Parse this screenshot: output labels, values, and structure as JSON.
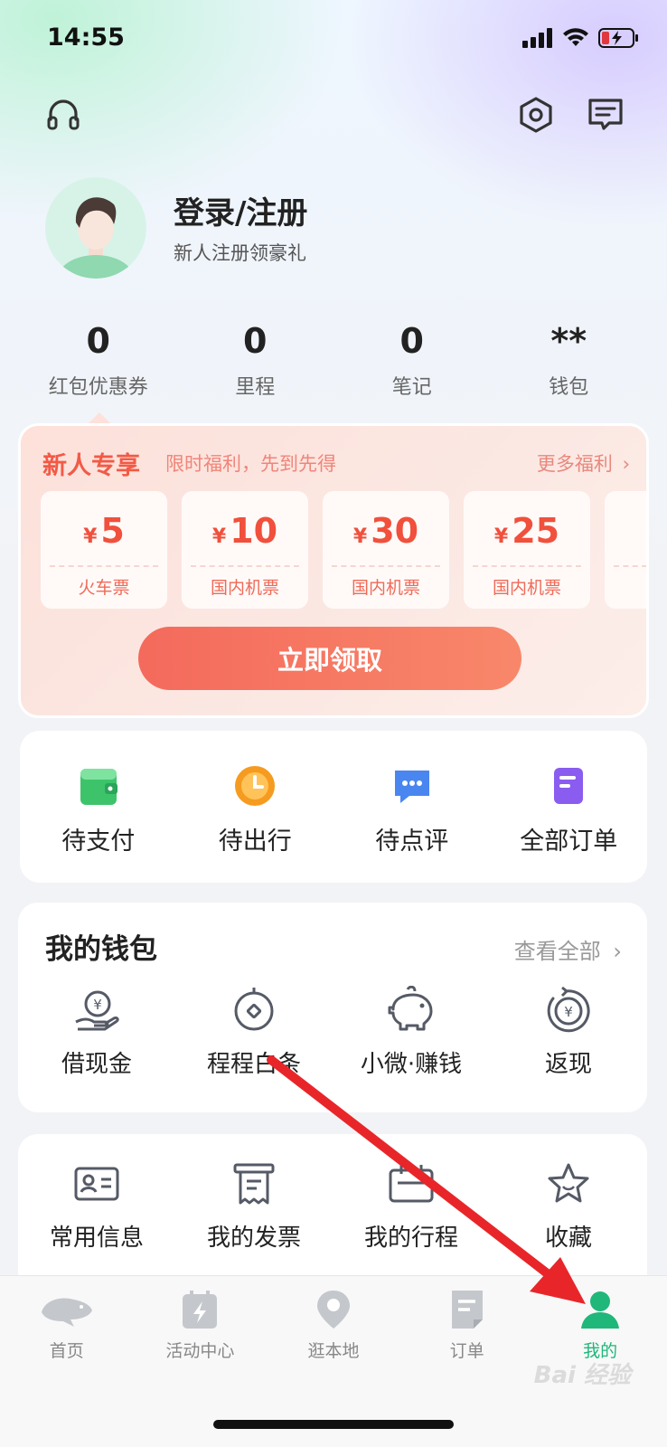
{
  "status_bar": {
    "time": "14:55"
  },
  "header": {
    "support_icon": "headset-icon",
    "settings_icon": "settings-hex-icon",
    "message_icon": "message-icon"
  },
  "profile": {
    "title": "登录/注册",
    "subtitle": "新人注册领豪礼"
  },
  "stats": [
    {
      "value": "0",
      "label": "红包优惠券"
    },
    {
      "value": "0",
      "label": "里程"
    },
    {
      "value": "0",
      "label": "笔记"
    },
    {
      "value": "**",
      "label": "钱包"
    }
  ],
  "promo": {
    "title": "新人专享",
    "subtitle": "限时福利，先到先得",
    "more": "更多福利",
    "currency": "¥",
    "coupons": [
      {
        "amount": "5",
        "label": "火车票"
      },
      {
        "amount": "10",
        "label": "国内机票"
      },
      {
        "amount": "30",
        "label": "国内机票"
      },
      {
        "amount": "25",
        "label": "国内机票"
      },
      {
        "amount": "",
        "label": "国"
      }
    ],
    "claim_button": "立即领取"
  },
  "orders": [
    {
      "label": "待支付",
      "icon": "wallet-green-icon",
      "color": "#3dc46b"
    },
    {
      "label": "待出行",
      "icon": "clock-orange-icon",
      "color": "#f59b1f"
    },
    {
      "label": "待点评",
      "icon": "chat-blue-icon",
      "color": "#4a86f0"
    },
    {
      "label": "全部订单",
      "icon": "document-purple-icon",
      "color": "#8a5cf0"
    }
  ],
  "wallet": {
    "title": "我的钱包",
    "more": "查看全部",
    "items": [
      {
        "label": "借现金",
        "icon": "cash-hand-icon"
      },
      {
        "label": "程程白条",
        "icon": "coin-icon"
      },
      {
        "label": "小微·赚钱",
        "icon": "piggy-bank-icon"
      },
      {
        "label": "返现",
        "icon": "cashback-icon"
      }
    ]
  },
  "services": [
    {
      "label": "常用信息",
      "icon": "id-card-icon"
    },
    {
      "label": "我的发票",
      "icon": "invoice-icon"
    },
    {
      "label": "我的行程",
      "icon": "itinerary-icon"
    },
    {
      "label": "收藏",
      "icon": "star-icon"
    }
  ],
  "tabbar": [
    {
      "label": "首页",
      "icon": "home-dolphin-icon",
      "active": false
    },
    {
      "label": "活动中心",
      "icon": "activity-icon",
      "active": false
    },
    {
      "label": "逛本地",
      "icon": "location-icon",
      "active": false
    },
    {
      "label": "订单",
      "icon": "order-icon",
      "active": false
    },
    {
      "label": "我的",
      "icon": "profile-icon",
      "active": true
    }
  ],
  "watermark": "Bai 经验"
}
